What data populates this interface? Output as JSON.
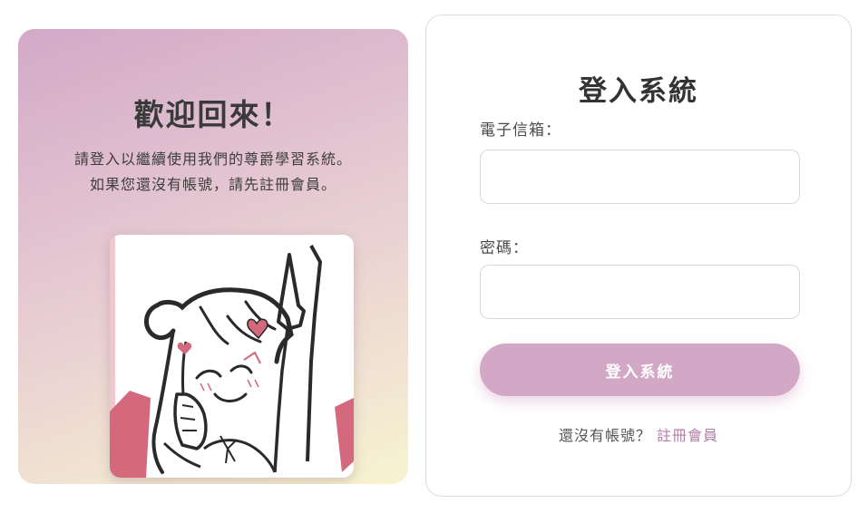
{
  "welcome": {
    "title": "歡迎回來！",
    "line1": "請登入以繼續使用我們的尊爵學習系統。",
    "line2": "如果您還沒有帳號，請先註冊會員。"
  },
  "login": {
    "title": "登入系統",
    "email_label": "電子信箱：",
    "email_value": "",
    "password_label": "密碼：",
    "password_value": "",
    "submit_label": "登入系統",
    "no_account_text": "還沒有帳號？",
    "register_link": "註冊會員"
  },
  "colors": {
    "accent": "#d3a8c7",
    "link": "#b47ea8",
    "panel_gradient_start": "#d2a9c8",
    "panel_gradient_end": "#f8f3cf"
  }
}
